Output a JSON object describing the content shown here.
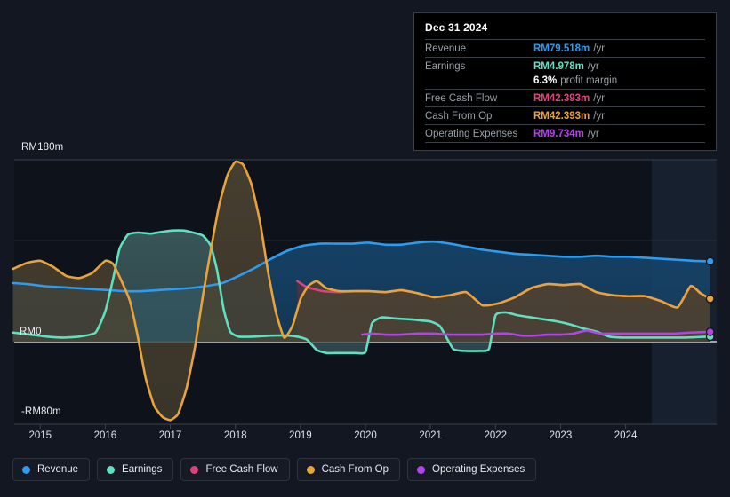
{
  "chart_data": {
    "type": "area",
    "title": "",
    "currency": "RM",
    "xlabel": "",
    "ylabel": "",
    "ylim": [
      -80,
      180
    ],
    "yticks": [
      {
        "label": "RM180m",
        "value": 180
      },
      {
        "label": "RM0",
        "value": 0
      },
      {
        "label": "-RM80m",
        "value": -80
      }
    ],
    "grid": true,
    "legend_position": "bottom",
    "xticks": [
      "2015",
      "2016",
      "2017",
      "2018",
      "2019",
      "2020",
      "2021",
      "2022",
      "2023",
      "2024"
    ],
    "x_range": [
      "2014.6",
      "2025.4"
    ],
    "forecast_region_start": "2024.4",
    "series": [
      {
        "name": "Revenue",
        "color": "#2d9bf0",
        "fill": "#16456b",
        "end_value": 79.518,
        "points": [
          [
            2014.58,
            58
          ],
          [
            2014.8,
            57
          ],
          [
            2015.05,
            55
          ],
          [
            2015.3,
            54
          ],
          [
            2015.55,
            53
          ],
          [
            2015.8,
            52
          ],
          [
            2016.05,
            51
          ],
          [
            2016.3,
            50
          ],
          [
            2016.55,
            50
          ],
          [
            2016.8,
            51
          ],
          [
            2017.05,
            52
          ],
          [
            2017.3,
            53
          ],
          [
            2017.55,
            55
          ],
          [
            2017.8,
            58
          ],
          [
            2018.05,
            65
          ],
          [
            2018.3,
            73
          ],
          [
            2018.55,
            82
          ],
          [
            2018.8,
            90
          ],
          [
            2019.05,
            95
          ],
          [
            2019.3,
            97
          ],
          [
            2019.55,
            97
          ],
          [
            2019.8,
            97
          ],
          [
            2020.05,
            98
          ],
          [
            2020.3,
            96
          ],
          [
            2020.55,
            96
          ],
          [
            2020.8,
            98
          ],
          [
            2021.05,
            99
          ],
          [
            2021.3,
            97
          ],
          [
            2021.55,
            94
          ],
          [
            2021.8,
            91
          ],
          [
            2022.05,
            89
          ],
          [
            2022.3,
            87
          ],
          [
            2022.55,
            86
          ],
          [
            2022.8,
            85
          ],
          [
            2023.05,
            84
          ],
          [
            2023.3,
            84
          ],
          [
            2023.55,
            85
          ],
          [
            2023.8,
            84
          ],
          [
            2024.05,
            84
          ],
          [
            2024.3,
            83
          ],
          [
            2024.55,
            82
          ],
          [
            2024.8,
            81
          ],
          [
            2025.05,
            80
          ],
          [
            2025.3,
            79.518
          ]
        ]
      },
      {
        "name": "Free Cash Flow",
        "color": "#d9427a",
        "fill": "#4b3442",
        "end_value": 42.393,
        "points": [
          [
            2018.95,
            60
          ],
          [
            2019.1,
            54
          ],
          [
            2019.35,
            50
          ],
          [
            2019.6,
            49
          ],
          [
            2019.85,
            50
          ],
          [
            2020.05,
            50
          ],
          [
            2020.3,
            49
          ],
          [
            2020.55,
            51
          ],
          [
            2020.8,
            48
          ],
          [
            2021.05,
            44
          ],
          [
            2021.3,
            46
          ],
          [
            2021.55,
            49
          ],
          [
            2021.8,
            36
          ],
          [
            2022.05,
            38
          ],
          [
            2022.3,
            44
          ],
          [
            2022.55,
            53
          ],
          [
            2022.8,
            57
          ],
          [
            2023.05,
            56
          ],
          [
            2023.3,
            57
          ],
          [
            2023.55,
            49
          ],
          [
            2023.8,
            46
          ],
          [
            2024.05,
            45
          ],
          [
            2024.3,
            45
          ],
          [
            2024.55,
            40
          ],
          [
            2024.8,
            34
          ],
          [
            2025.0,
            55
          ],
          [
            2025.15,
            48
          ],
          [
            2025.3,
            42.393
          ]
        ]
      },
      {
        "name": "Cash From Op",
        "color": "#e8a33d",
        "fill": "#4b4230",
        "end_value": 42.393,
        "points": [
          [
            2014.58,
            72
          ],
          [
            2014.8,
            78
          ],
          [
            2015.0,
            80
          ],
          [
            2015.2,
            74
          ],
          [
            2015.4,
            65
          ],
          [
            2015.6,
            63
          ],
          [
            2015.8,
            68
          ],
          [
            2016.0,
            80
          ],
          [
            2016.12,
            77
          ],
          [
            2016.25,
            60
          ],
          [
            2016.38,
            40
          ],
          [
            2016.5,
            5
          ],
          [
            2016.62,
            -35
          ],
          [
            2016.75,
            -62
          ],
          [
            2016.88,
            -73
          ],
          [
            2017.0,
            -76
          ],
          [
            2017.12,
            -70
          ],
          [
            2017.25,
            -45
          ],
          [
            2017.38,
            -5
          ],
          [
            2017.5,
            45
          ],
          [
            2017.62,
            90
          ],
          [
            2017.75,
            135
          ],
          [
            2017.88,
            165
          ],
          [
            2018.0,
            178
          ],
          [
            2018.12,
            175
          ],
          [
            2018.25,
            155
          ],
          [
            2018.38,
            118
          ],
          [
            2018.5,
            70
          ],
          [
            2018.62,
            30
          ],
          [
            2018.75,
            4
          ],
          [
            2018.88,
            16
          ],
          [
            2019.0,
            42
          ],
          [
            2019.12,
            55
          ],
          [
            2019.25,
            60
          ],
          [
            2019.4,
            53
          ],
          [
            2019.6,
            50
          ],
          [
            2019.85,
            50
          ],
          [
            2020.05,
            50
          ],
          [
            2020.3,
            49
          ],
          [
            2020.55,
            51
          ],
          [
            2020.8,
            48
          ],
          [
            2021.05,
            44
          ],
          [
            2021.3,
            46
          ],
          [
            2021.55,
            49
          ],
          [
            2021.8,
            36
          ],
          [
            2022.05,
            38
          ],
          [
            2022.3,
            44
          ],
          [
            2022.55,
            53
          ],
          [
            2022.8,
            57
          ],
          [
            2023.05,
            56
          ],
          [
            2023.3,
            57
          ],
          [
            2023.55,
            49
          ],
          [
            2023.8,
            46
          ],
          [
            2024.05,
            45
          ],
          [
            2024.3,
            45
          ],
          [
            2024.55,
            40
          ],
          [
            2024.8,
            34
          ],
          [
            2025.0,
            55
          ],
          [
            2025.15,
            48
          ],
          [
            2025.3,
            42.393
          ]
        ]
      },
      {
        "name": "Earnings",
        "color": "#62dec0",
        "fill": "#3b5a5c",
        "end_value": 4.978,
        "points": [
          [
            2014.58,
            9
          ],
          [
            2014.85,
            7
          ],
          [
            2015.1,
            5
          ],
          [
            2015.35,
            4
          ],
          [
            2015.6,
            5
          ],
          [
            2015.85,
            9
          ],
          [
            2016.0,
            30
          ],
          [
            2016.12,
            62
          ],
          [
            2016.22,
            92
          ],
          [
            2016.35,
            106
          ],
          [
            2016.5,
            108
          ],
          [
            2016.7,
            107
          ],
          [
            2016.9,
            109
          ],
          [
            2017.05,
            110
          ],
          [
            2017.2,
            110
          ],
          [
            2017.35,
            108
          ],
          [
            2017.5,
            105
          ],
          [
            2017.62,
            95
          ],
          [
            2017.72,
            70
          ],
          [
            2017.82,
            32
          ],
          [
            2017.92,
            10
          ],
          [
            2018.05,
            5
          ],
          [
            2018.3,
            5
          ],
          [
            2018.55,
            6
          ],
          [
            2018.8,
            6
          ],
          [
            2018.95,
            5
          ],
          [
            2019.1,
            2
          ],
          [
            2019.25,
            -8
          ],
          [
            2019.4,
            -11
          ],
          [
            2019.6,
            -11
          ],
          [
            2019.85,
            -11
          ],
          [
            2020.0,
            -10
          ],
          [
            2020.1,
            18
          ],
          [
            2020.25,
            24
          ],
          [
            2020.45,
            23
          ],
          [
            2020.7,
            22
          ],
          [
            2020.85,
            21
          ],
          [
            2021.0,
            20
          ],
          [
            2021.15,
            15
          ],
          [
            2021.35,
            -7
          ],
          [
            2021.55,
            -9
          ],
          [
            2021.75,
            -9
          ],
          [
            2021.9,
            -7
          ],
          [
            2022.0,
            26
          ],
          [
            2022.15,
            29
          ],
          [
            2022.35,
            26
          ],
          [
            2022.55,
            24
          ],
          [
            2022.75,
            22
          ],
          [
            2022.95,
            20
          ],
          [
            2023.15,
            17
          ],
          [
            2023.35,
            13
          ],
          [
            2023.55,
            10
          ],
          [
            2023.75,
            5
          ],
          [
            2023.95,
            4
          ],
          [
            2024.15,
            4
          ],
          [
            2024.4,
            4
          ],
          [
            2024.65,
            4
          ],
          [
            2024.9,
            4
          ],
          [
            2025.1,
            4.5
          ],
          [
            2025.3,
            4.978
          ]
        ]
      },
      {
        "name": "Operating Expenses",
        "color": "#b344e8",
        "fill": "none",
        "end_value": 9.734,
        "points": [
          [
            2019.95,
            7
          ],
          [
            2020.1,
            8
          ],
          [
            2020.3,
            7
          ],
          [
            2020.55,
            7
          ],
          [
            2020.8,
            8
          ],
          [
            2021.05,
            8
          ],
          [
            2021.3,
            7
          ],
          [
            2021.55,
            7
          ],
          [
            2021.8,
            7
          ],
          [
            2022.0,
            8
          ],
          [
            2022.2,
            8
          ],
          [
            2022.4,
            6
          ],
          [
            2022.6,
            6
          ],
          [
            2022.8,
            7
          ],
          [
            2023.0,
            7
          ],
          [
            2023.2,
            8
          ],
          [
            2023.4,
            11
          ],
          [
            2023.6,
            8
          ],
          [
            2023.8,
            8
          ],
          [
            2024.0,
            8
          ],
          [
            2024.25,
            8
          ],
          [
            2024.5,
            8
          ],
          [
            2024.75,
            8
          ],
          [
            2025.0,
            9
          ],
          [
            2025.3,
            9.734
          ]
        ]
      }
    ]
  },
  "tooltip": {
    "date": "Dec 31 2024",
    "rows": [
      {
        "key": "Revenue",
        "value": "RM79.518m",
        "unit": "/yr",
        "color": "#2d9bf0"
      },
      {
        "key": "Earnings",
        "value": "RM4.978m",
        "unit": "/yr",
        "color": "#62dec0"
      },
      {
        "key": "",
        "value": "6.3%",
        "unit": "profit margin",
        "color": "#ffffff"
      },
      {
        "key": "Free Cash Flow",
        "value": "RM42.393m",
        "unit": "/yr",
        "color": "#e0457f"
      },
      {
        "key": "Cash From Op",
        "value": "RM42.393m",
        "unit": "/yr",
        "color": "#e8a33d"
      },
      {
        "key": "Operating Expenses",
        "value": "RM9.734m",
        "unit": "/yr",
        "color": "#b344e8"
      }
    ]
  },
  "legend": {
    "items": [
      {
        "label": "Revenue",
        "color": "#2d9bf0"
      },
      {
        "label": "Earnings",
        "color": "#62dec0"
      },
      {
        "label": "Free Cash Flow",
        "color": "#d9427a"
      },
      {
        "label": "Cash From Op",
        "color": "#e8a33d"
      },
      {
        "label": "Operating Expenses",
        "color": "#b344e8"
      }
    ]
  }
}
